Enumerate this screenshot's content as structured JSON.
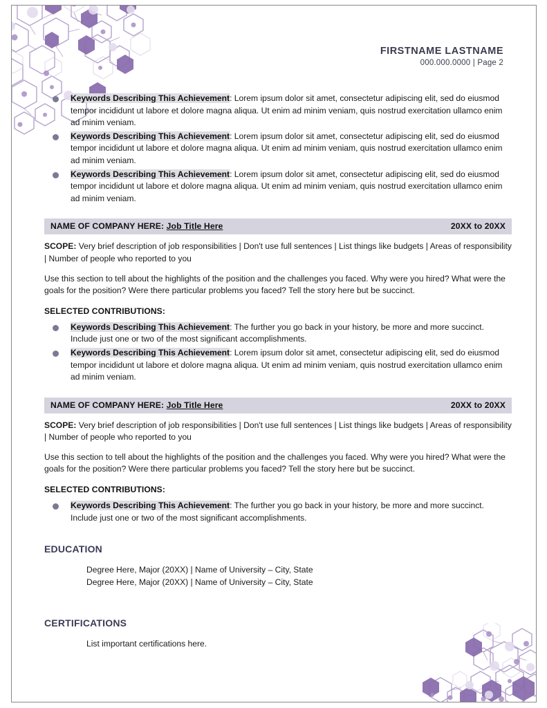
{
  "header": {
    "name": "FIRSTNAME LASTNAME",
    "contact": "000.000.0000  | Page 2"
  },
  "top_bullets": [
    {
      "keyword": "Keywords Describing This Achievement",
      "text": ": Lorem ipsum dolor sit amet, consectetur adipiscing elit, sed do eiusmod tempor incididunt ut labore et dolore magna aliqua. Ut enim ad minim veniam, quis nostrud exercitation ullamco enim ad minim veniam."
    },
    {
      "keyword": "Keywords Describing This Achievement",
      "text": ": Lorem ipsum dolor sit amet, consectetur adipiscing elit, sed do eiusmod tempor incididunt ut labore et dolore magna aliqua. Ut enim ad minim veniam, quis nostrud exercitation ullamco enim ad minim veniam."
    },
    {
      "keyword": "Keywords Describing This Achievement",
      "text": ": Lorem ipsum dolor sit amet, consectetur adipiscing elit, sed do eiusmod tempor incididunt ut labore et dolore magna aliqua. Ut enim ad minim veniam, quis nostrud exercitation ullamco enim ad minim veniam."
    }
  ],
  "jobs": [
    {
      "company_label": "NAME OF COMPANY HERE:",
      "job_title": "Job Title Here",
      "dates": "20XX to 20XX",
      "scope_label": "SCOPE:",
      "scope_text": " Very brief description of job responsibilities | Don't use full sentences | List things like budgets | Areas of responsibility | Number of people who reported to you",
      "story": "Use this section to tell about the highlights of the position and the challenges you faced. Why were you hired? What were the goals for the position? Were there particular problems you faced? Tell the story here but be succinct.",
      "contributions_label": "SELECTED CONTRIBUTIONS:",
      "bullets": [
        {
          "keyword": "Keywords Describing This Achievement",
          "text": ": The further you go back in your history, be more and more succinct. Include just one or two of the most significant accomplishments."
        },
        {
          "keyword": "Keywords Describing This Achievement",
          "text": ": Lorem ipsum dolor sit amet, consectetur adipiscing elit, sed do eiusmod tempor incididunt ut labore et dolore magna aliqua. Ut enim ad minim veniam, quis nostrud exercitation ullamco enim ad minim veniam."
        }
      ]
    },
    {
      "company_label": "NAME OF COMPANY HERE:",
      "job_title": "Job Title Here",
      "dates": "20XX to 20XX",
      "scope_label": "SCOPE:",
      "scope_text": " Very brief description of job responsibilities | Don't use full sentences | List things like budgets | Areas of responsibility | Number of people who reported to you",
      "story": "Use this section to tell about the highlights of the position and the challenges you faced. Why were you hired? What were the goals for the position? Were there particular problems you faced? Tell the story here but be succinct.",
      "contributions_label": "SELECTED CONTRIBUTIONS:",
      "bullets": [
        {
          "keyword": "Keywords Describing This Achievement",
          "text": ": The further you go back in your history, be more and more succinct. Include just one or two of the most significant accomplishments."
        }
      ]
    }
  ],
  "education": {
    "heading": "EDUCATION",
    "entries": [
      "Degree Here, Major (20XX) | Name of University – City,  State",
      "Degree Here, Major (20XX) | Name of University – City,  State"
    ]
  },
  "certifications": {
    "heading": "CERTIFICATIONS",
    "entries": [
      "List important certifications here."
    ]
  },
  "theme": {
    "accent_purple": "#8b6fae",
    "bullet_color": "#7b7a94",
    "bar_background": "#d5d3de",
    "highlight_background": "#dddde3",
    "heading_color": "#3b3b57",
    "page_border": "#888888"
  }
}
